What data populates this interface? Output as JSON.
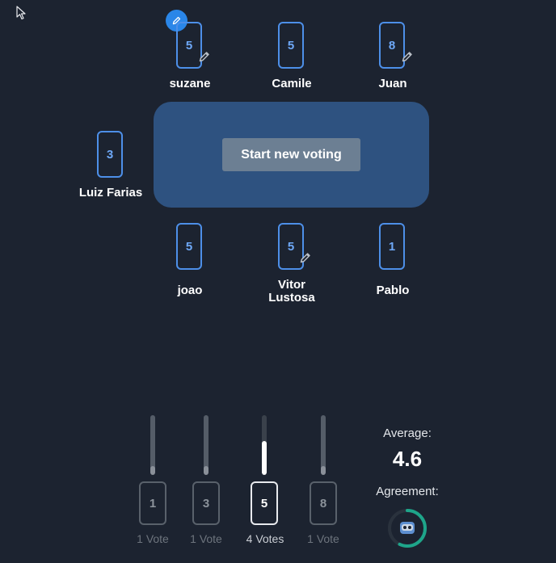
{
  "table": {
    "start_button_label": "Start new voting"
  },
  "players": [
    {
      "name": "suzane",
      "vote": "5",
      "edited": true,
      "is_self": true
    },
    {
      "name": "Camile",
      "vote": "5",
      "edited": false
    },
    {
      "name": "Juan",
      "vote": "8",
      "edited": true
    },
    {
      "name": "Luiz Farias",
      "vote": "3",
      "edited": false
    },
    {
      "name": "joao",
      "vote": "5",
      "edited": false
    },
    {
      "name": "Vitor Lustosa",
      "vote": "5",
      "edited": true
    },
    {
      "name": "Pablo",
      "vote": "1",
      "edited": false
    }
  ],
  "results": {
    "max_votes": 7,
    "options": [
      {
        "value": "1",
        "votes": 1,
        "label": "1 Vote",
        "selected": false
      },
      {
        "value": "3",
        "votes": 1,
        "label": "1 Vote",
        "selected": false
      },
      {
        "value": "5",
        "votes": 4,
        "label": "4 Votes",
        "selected": true
      },
      {
        "value": "8",
        "votes": 1,
        "label": "1 Vote",
        "selected": false
      }
    ],
    "average_label": "Average:",
    "average_value": "4.6",
    "agreement_label": "Agreement:",
    "agreement_fraction": 0.57
  },
  "colors": {
    "background": "#1c2330",
    "table": "#2e5280",
    "card_border": "#4d8fe8",
    "accent_teal": "#1ea58a",
    "edit_badge": "#2a86e8"
  },
  "icons": {
    "cursor": "mouse-pointer-icon",
    "edit": "pencil-icon",
    "agreement": "meeple-icon"
  }
}
